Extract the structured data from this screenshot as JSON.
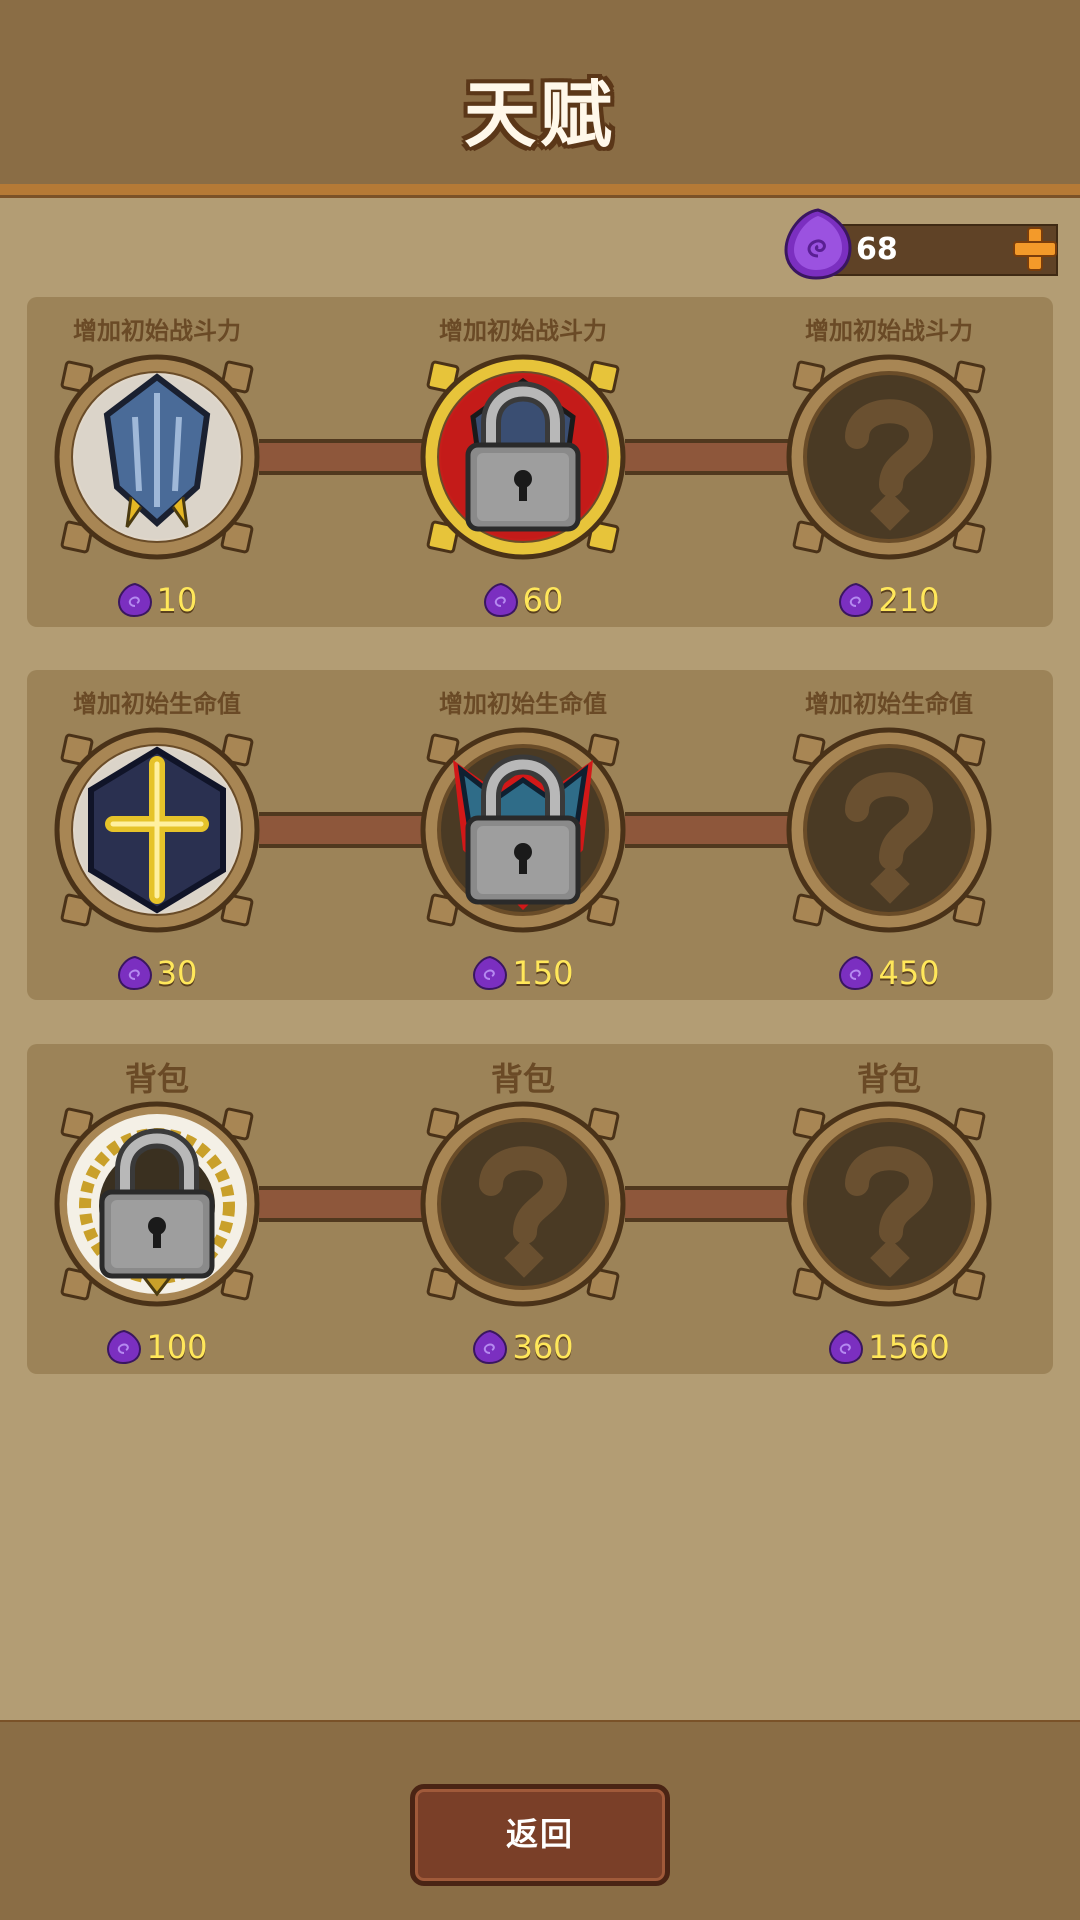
{
  "header": {
    "title": "天赋"
  },
  "currency": {
    "amount": "68",
    "icon": "purple-gem-icon",
    "add_icon": "plus-icon"
  },
  "rows": [
    {
      "nodes": [
        {
          "label": "增加初始战斗力",
          "cost": "10",
          "state": "unlocked",
          "icon": "shield-icon"
        },
        {
          "label": "增加初始战斗力",
          "cost": "60",
          "state": "locked-selected",
          "icon": "lock-icon"
        },
        {
          "label": "增加初始战斗力",
          "cost": "210",
          "state": "unknown",
          "icon": "question-icon"
        }
      ]
    },
    {
      "nodes": [
        {
          "label": "增加初始生命值",
          "cost": "30",
          "state": "unlocked",
          "icon": "cross-hexagon-icon"
        },
        {
          "label": "增加初始生命值",
          "cost": "150",
          "state": "locked",
          "icon": "lock-icon"
        },
        {
          "label": "增加初始生命值",
          "cost": "450",
          "state": "unknown",
          "icon": "question-icon"
        }
      ]
    },
    {
      "nodes": [
        {
          "label": "背包",
          "cost": "100",
          "state": "locked-laurel",
          "icon": "lock-icon"
        },
        {
          "label": "背包",
          "cost": "360",
          "state": "unknown",
          "icon": "question-icon"
        },
        {
          "label": "背包",
          "cost": "1560",
          "state": "unknown",
          "icon": "question-icon"
        }
      ]
    }
  ],
  "footer": {
    "back_label": "返回"
  },
  "colors": {
    "cost_text": "#ffe75a",
    "gem": "#8b3fd1",
    "lock_glow": "#e21b1b",
    "selected_ring": "#e7c43a"
  }
}
